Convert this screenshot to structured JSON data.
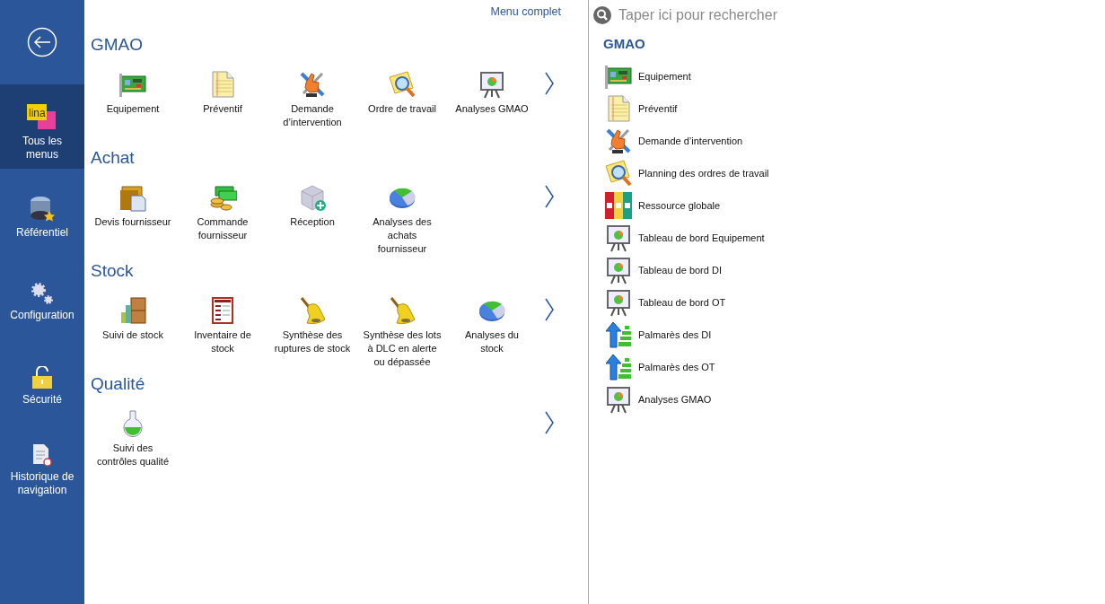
{
  "sidebar": {
    "logo_text": "lina",
    "items": [
      {
        "label": "Tous les menus",
        "selected": true
      },
      {
        "label": "Référentiel",
        "selected": false
      },
      {
        "label": "Configuration",
        "selected": false
      },
      {
        "label": "Sécurité",
        "selected": false
      },
      {
        "label": "Historique de navigation",
        "selected": false
      }
    ]
  },
  "menu": {
    "link": "Menu complet",
    "sections": [
      {
        "title": "GMAO",
        "items": [
          {
            "label": "Equipement"
          },
          {
            "label": "Préventif"
          },
          {
            "label": "Demande\nd’intervention"
          },
          {
            "label": "Ordre de travail"
          },
          {
            "label": "Analyses GMAO"
          }
        ]
      },
      {
        "title": "Achat",
        "items": [
          {
            "label": "Devis fournisseur"
          },
          {
            "label": "Commande\nfournisseur"
          },
          {
            "label": "Réception"
          },
          {
            "label": "Analyses des\nachats\nfournisseur"
          }
        ]
      },
      {
        "title": "Stock",
        "items": [
          {
            "label": "Suivi de stock"
          },
          {
            "label": "Inventaire de\nstock"
          },
          {
            "label": "Synthèse des\nruptures de stock"
          },
          {
            "label": "Synthèse des lots\nà DLC en alerte\nou dépassée"
          },
          {
            "label": "Analyses du\nstock"
          }
        ]
      },
      {
        "title": "Qualité",
        "items": [
          {
            "label": "Suivi des\ncontrôles qualité"
          }
        ]
      }
    ]
  },
  "search": {
    "placeholder": "Taper ici pour rechercher"
  },
  "results": {
    "title": "GMAO",
    "items": [
      {
        "label": "Equipement"
      },
      {
        "label": "Préventif"
      },
      {
        "label": "Demande d’intervention"
      },
      {
        "label": "Planning des ordres de travail"
      },
      {
        "label": "Ressource globale"
      },
      {
        "label": "Tableau de bord Equipement"
      },
      {
        "label": "Tableau de bord DI"
      },
      {
        "label": "Tableau de bord OT"
      },
      {
        "label": "Palmarès des DI"
      },
      {
        "label": "Palmarès des OT"
      },
      {
        "label": "Analyses GMAO"
      }
    ]
  }
}
